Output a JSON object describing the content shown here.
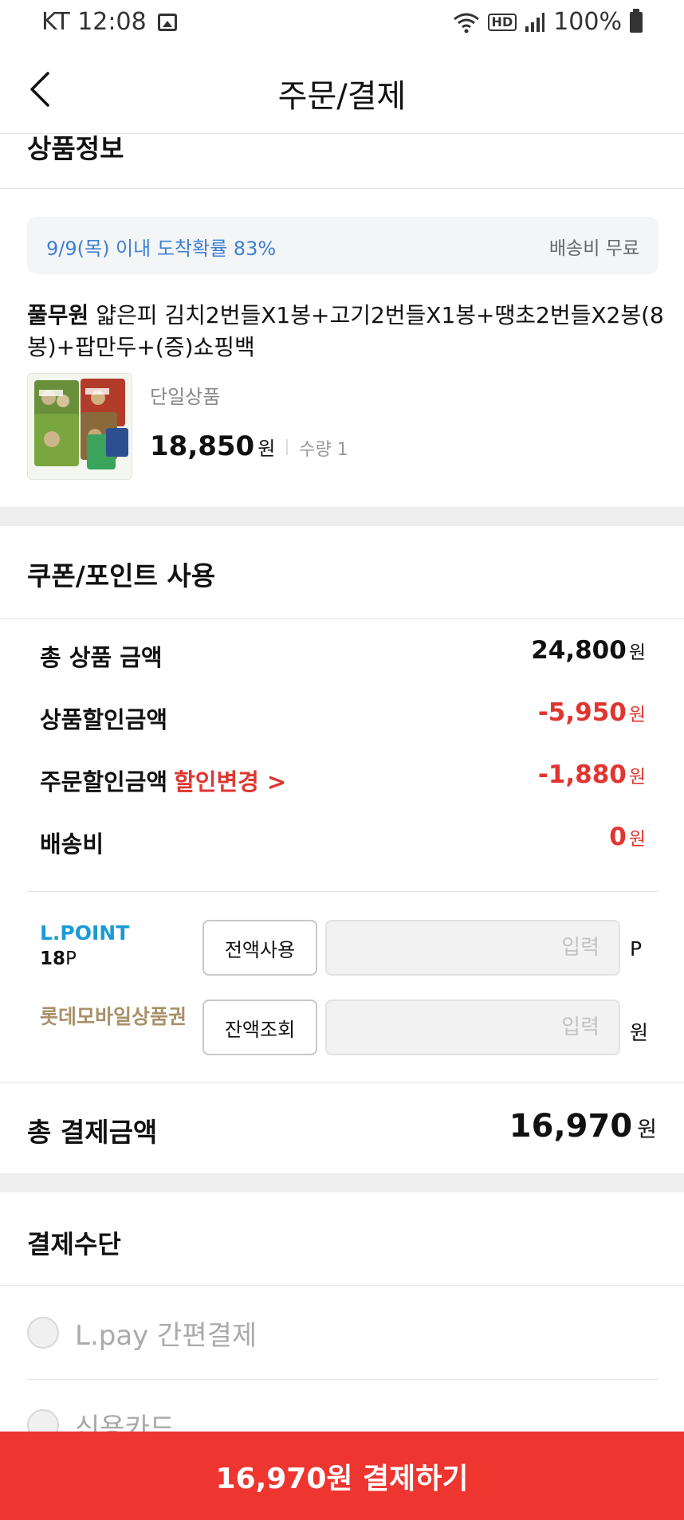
{
  "status_bar": {
    "carrier_time": "KT 12:08",
    "battery": "100%",
    "hd": "HD"
  },
  "header": {
    "title": "주문/결제"
  },
  "product_section": {
    "title": "상품정보",
    "delivery_eta": "9/9(목) 이내 도착확률 83%",
    "delivery_fee": "배송비 무료",
    "brand": "풀무원",
    "name": "얇은피 김치2번들X1봉+고기2번들X1봉+땡초2번들X2봉(8봉)+팝만두+(증)쇼핑백",
    "option": "단일상품",
    "price": "18,850",
    "price_unit": "원",
    "quantity": "수량 1"
  },
  "coupon_section": {
    "title": "쿠폰/포인트 사용",
    "rows": [
      {
        "label": "총 상품 금액",
        "value": "24,800",
        "unit": "원"
      },
      {
        "label": "상품할인금액",
        "value": "-5,950",
        "unit": "원"
      },
      {
        "label": "주문할인금액",
        "link": "할인변경 >",
        "value": "-1,880",
        "unit": "원"
      },
      {
        "label": "배송비",
        "value": "0",
        "unit": "원"
      }
    ],
    "lpoint": {
      "label": "L.POINT",
      "balance": "18",
      "balance_unit": "P",
      "button": "전액사용",
      "placeholder": "입력",
      "unit": "P"
    },
    "gift_card": {
      "label": "롯데모바일상품권",
      "button": "잔액조회",
      "placeholder": "입력",
      "unit": "원"
    }
  },
  "total": {
    "label": "총 결제금액",
    "value": "16,970",
    "unit": "원"
  },
  "payment_method": {
    "title": "결제수단",
    "options": [
      "L.pay 간편결제",
      "신용카드"
    ]
  },
  "cta": {
    "label": "16,970원 결제하기"
  },
  "colors": {
    "accent_red": "#ee3530",
    "discount_red": "#e03530",
    "lpoint_blue": "#1a9ad6",
    "eta_blue": "#3d7fd4",
    "gift_gold": "#a8916a"
  }
}
